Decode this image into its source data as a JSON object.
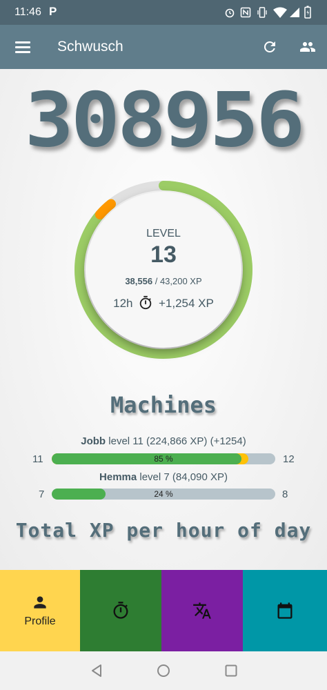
{
  "status": {
    "time": "11:46",
    "p_label": "P"
  },
  "appbar": {
    "title": "Schwusch",
    "menu_icon": "menu-icon",
    "refresh_icon": "refresh-icon",
    "people_icon": "people-icon"
  },
  "total_xp": "308956",
  "level": {
    "label": "LEVEL",
    "value": "13",
    "xp_current": "38,556",
    "xp_sep": " / ",
    "xp_target": "43,200 XP",
    "progress": 0.8925,
    "rate_hours": "12h",
    "rate_gain": "+1,254 XP",
    "gain_fraction": 0.029
  },
  "machines": {
    "title": "Machines",
    "items": [
      {
        "name": "Jobb",
        "detail": " level 11 (224,866 XP) (+1254)",
        "from": "11",
        "to": "12",
        "pct_label": "85 %",
        "pct": 85,
        "extra_pct": 3
      },
      {
        "name": "Hemma",
        "detail": " level 7 (84,090 XP)",
        "from": "7",
        "to": "8",
        "pct_label": "24 %",
        "pct": 24,
        "extra_pct": 0
      }
    ]
  },
  "chart_section": {
    "title": "Total XP per hour of day"
  },
  "bottom_nav": [
    {
      "label": "Profile",
      "icon": "person-icon",
      "color": "#ffd54f"
    },
    {
      "label": "",
      "icon": "timer-icon",
      "color": "#2e7d32"
    },
    {
      "label": "",
      "icon": "translate-icon",
      "color": "#7b1fa2"
    },
    {
      "label": "",
      "icon": "calendar-icon",
      "color": "#0097a7"
    }
  ],
  "colors": {
    "appbar": "#607d8b",
    "statusbar": "#4f6672",
    "ring": "#9ccc65",
    "ring_track": "#e0e0e0",
    "ring_gain": "#ff9800"
  }
}
